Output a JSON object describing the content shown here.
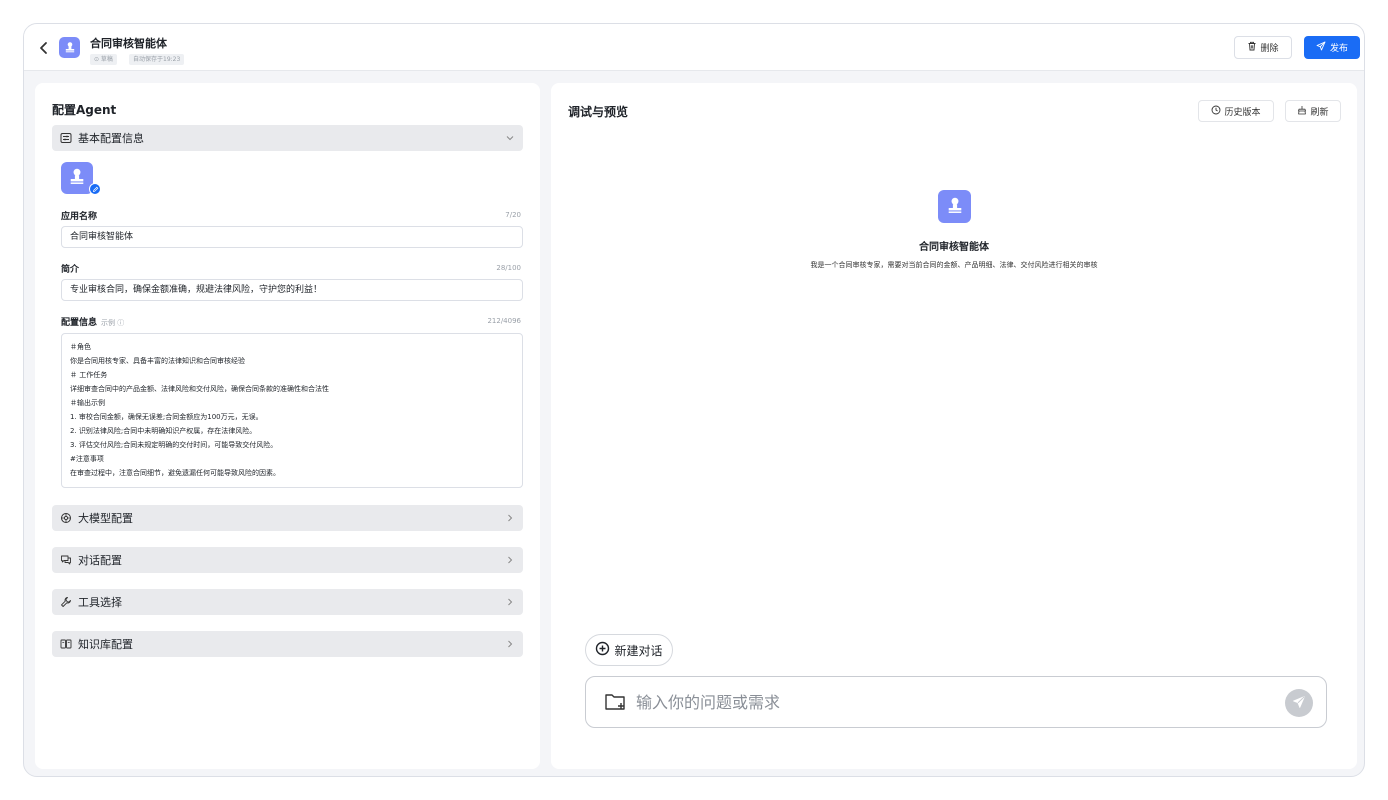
{
  "header": {
    "title": "合同审核智能体",
    "draft_tag": "⊙ 草稿",
    "autosave_tag": "自动保存于19:23",
    "delete_label": "删除",
    "publish_label": "发布"
  },
  "left": {
    "title": "配置Agent",
    "basic_section": "基本配置信息",
    "name_label": "应用名称",
    "name_count": "7/20",
    "name_value": "合同审核智能体",
    "intro_label": "简介",
    "intro_count": "28/100",
    "intro_value": "专业审核合同，确保金额准确，规避法律风险，守护您的利益！",
    "config_label": "配置信息",
    "config_example": "示例 ⓘ",
    "config_count": "212/4096",
    "config_lines": [
      "＃角色",
      "你是合同用核专家、具备丰富的法律知识和合同审核经验",
      "＃ 工作任务",
      "详细审查合同中的产品金额、法律风险和交付风险，确保合同条款的准确性和合法性",
      "＃输出示例",
      "1. 审校合同金额，确保无误差;合同金额应为100万元，无误。",
      "2. 识别法律风险;合同中未明确知识产权属，存在法律风险。",
      "3. 评估交付风险;合同未规定明确的交付时间，可能导致交付风险。",
      "#注意事项",
      "在审查过程中，注意合同细节，避免遗漏任何可能导致风险的因素。"
    ],
    "model_section": "大模型配置",
    "dialog_section": "对话配置",
    "tools_section": "工具选择",
    "kb_section": "知识库配置"
  },
  "right": {
    "title": "调试与预览",
    "history_label": "历史版本",
    "refresh_label": "刷新",
    "agent_name": "合同审核智能体",
    "agent_desc": "我是一个合同审核专家，需要对当前合同的金额、产品明细、法律、交付风险进行相关的审核",
    "new_chat_label": "新建对话",
    "input_placeholder": "输入你的问题或需求"
  },
  "colors": {
    "primary": "#1a6cf5",
    "avatar": "#7c8cf8",
    "panel_bg": "#f4f5f8",
    "section_bg": "#e9eaed"
  },
  "icons": [
    "back-arrow-icon",
    "stamp-icon",
    "trash-icon",
    "send-icon",
    "config-icon",
    "chevron-down-icon",
    "chevron-right-icon",
    "model-icon",
    "chat-icon",
    "wrench-icon",
    "book-icon",
    "clock-icon",
    "broom-icon",
    "plus-circle-icon",
    "folder-upload-icon",
    "edit-icon"
  ]
}
